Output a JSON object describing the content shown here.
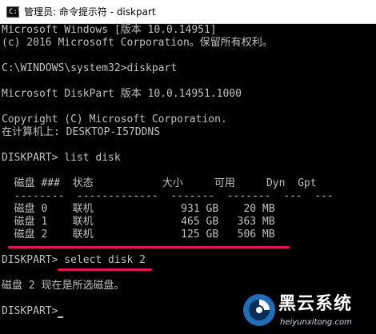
{
  "window": {
    "title": "管理员: 命令提示符 - diskpart",
    "icon": "console-icon",
    "icon_glyph": "C:\\"
  },
  "console": {
    "lines": [
      "Microsoft Windows [版本 10.0.14951]",
      "(c) 2016 Microsoft Corporation。保留所有权利。",
      "",
      "C:\\WINDOWS\\system32>diskpart",
      "",
      "Microsoft DiskPart 版本 10.0.14951.1000",
      "",
      "Copyright (C) Microsoft Corporation.",
      "在计算机上: DESKTOP-I57DDNS",
      "",
      "DISKPART> list disk",
      "",
      "  磁盘 ###  状态           大小     可用     Dyn  Gpt",
      "  --------  -------------  -------  -------  ---  ---",
      "  磁盘 0    联机              931 GB    20 MB",
      "  磁盘 1    联机              465 GB   363 MB",
      "  磁盘 2    联机              125 GB   506 MB",
      "",
      "DISKPART> select disk 2",
      "",
      "磁盘 2 现在是所选磁盘。",
      "",
      "DISKPART> "
    ],
    "text_color": "#c0c0c0",
    "background": "#000000",
    "highlight_color": "#e3145a"
  },
  "watermark": {
    "brand": "黑云系统",
    "url": "heiyunxitong.com"
  }
}
